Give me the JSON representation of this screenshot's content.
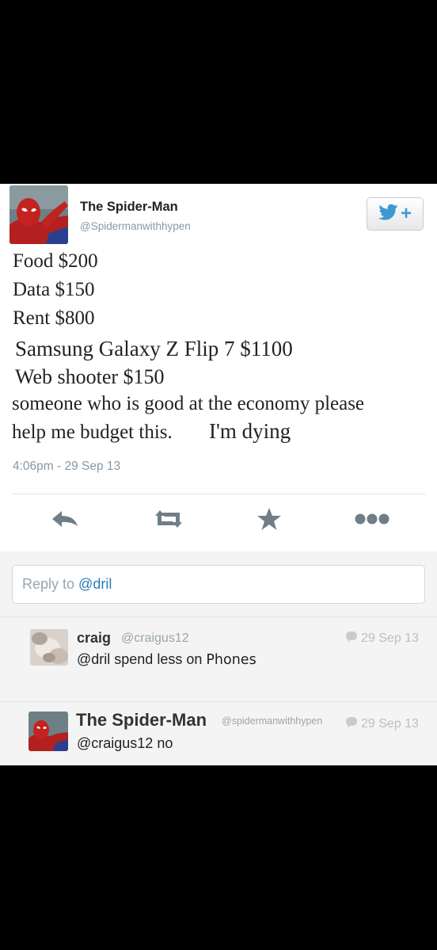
{
  "tweet": {
    "author_name": "The Spider-Man",
    "author_handle": "@Spidermanwithhypen",
    "follow_icon": "twitter-bird-icon",
    "lines": [
      "Food $200",
      "Data $150",
      "Rent $800",
      "Samsung Galaxy Z Flip 7 $1100",
      "Web shooter $150",
      "someone who is good at the economy please",
      "help me budget this.",
      "I'm dying"
    ],
    "timestamp": "4:06pm - 29 Sep 13",
    "actions": [
      "reply-icon",
      "retweet-icon",
      "favorite-icon",
      "more-icon"
    ]
  },
  "reply_box": {
    "prefix": "Reply to ",
    "mention": "@dril"
  },
  "replies": [
    {
      "name": "craig",
      "handle": "@craigus12",
      "date": "29 Sep 13",
      "text": "@dril spend less on ",
      "text_extra": "Phones"
    },
    {
      "name": "The Spider-Man",
      "handle": "@spidermanwithhypen",
      "date": "29 Sep 13",
      "text": "@craigus12 no"
    }
  ],
  "colors": {
    "accent": "#2b7bb9",
    "muted": "#8899a6",
    "reply_bg": "#f4f4f4"
  }
}
